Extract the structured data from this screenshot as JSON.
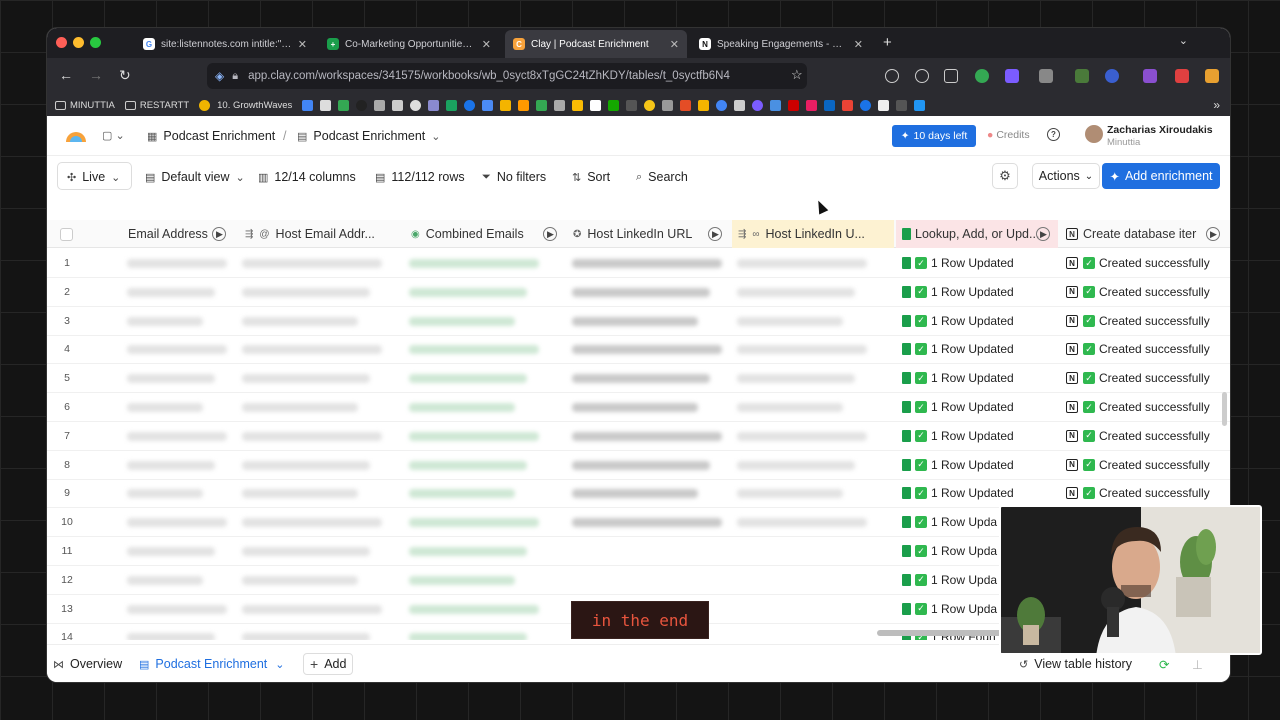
{
  "browser": {
    "tabs": [
      {
        "title": "site:listennotes.com intitle:\"growth\"",
        "active": false
      },
      {
        "title": "Co-Marketing Opportunities Ma",
        "active": false
      },
      {
        "title": "Clay | Podcast Enrichment",
        "active": true
      },
      {
        "title": "Speaking Engagements - Podca",
        "active": false
      }
    ],
    "new_tab": "+",
    "url": "app.clay.com/workspaces/341575/workbooks/wb_0syct8xTgGC24tZhKDY/tables/t_0syctfb6N4",
    "bookmarks": [
      "MINUTTIA",
      "RESTARTT",
      "10. GrowthWaves"
    ]
  },
  "app": {
    "breadcrumb": [
      "Podcast Enrichment",
      "Podcast Enrichment"
    ],
    "trial_label": "10 days left",
    "credits_label": "Credits",
    "help_icon": "?",
    "user": {
      "name": "Zacharias Xiroudakis",
      "org": "Minuttia"
    }
  },
  "toolbar": {
    "live": "Live",
    "view": "Default view",
    "columns": "12/14 columns",
    "rows": "112/112 rows",
    "filters": "No filters",
    "sort": "Sort",
    "search": "Search",
    "actions": "Actions",
    "add_enrichment": "Add enrichment"
  },
  "table": {
    "headers": [
      "Email Address",
      "Host Email Addr...",
      "Combined Emails",
      "Host LinkedIn URL",
      "Host LinkedIn U...",
      "Lookup, Add, or Upd...",
      "Create database iter"
    ],
    "rows": [
      {
        "n": "1",
        "lookup": "1 Row Updated",
        "create": "Created successfully"
      },
      {
        "n": "2",
        "lookup": "1 Row Updated",
        "create": "Created successfully"
      },
      {
        "n": "3",
        "lookup": "1 Row Updated",
        "create": "Created successfully"
      },
      {
        "n": "4",
        "lookup": "1 Row Updated",
        "create": "Created successfully"
      },
      {
        "n": "5",
        "lookup": "1 Row Updated",
        "create": "Created successfully"
      },
      {
        "n": "6",
        "lookup": "1 Row Updated",
        "create": "Created successfully"
      },
      {
        "n": "7",
        "lookup": "1 Row Updated",
        "create": "Created successfully"
      },
      {
        "n": "8",
        "lookup": "1 Row Updated",
        "create": "Created successfully"
      },
      {
        "n": "9",
        "lookup": "1 Row Updated",
        "create": "Created successfully"
      },
      {
        "n": "10",
        "lookup": "1 Row Upda",
        "create": ""
      },
      {
        "n": "11",
        "lookup": "1 Row Upda",
        "create": ""
      },
      {
        "n": "12",
        "lookup": "1 Row Upda",
        "create": ""
      },
      {
        "n": "13",
        "lookup": "1 Row Upda",
        "create": ""
      },
      {
        "n": "14",
        "lookup": "1 Row Foun",
        "create": ""
      }
    ]
  },
  "bottom": {
    "overview": "Overview",
    "table_tab": "Podcast Enrichment",
    "add": "Add",
    "history": "View table history"
  },
  "caption": "in the end",
  "colors": {
    "accent": "#1f6fe0",
    "success": "#2fb84f",
    "sheet": "#1a9e4b"
  }
}
